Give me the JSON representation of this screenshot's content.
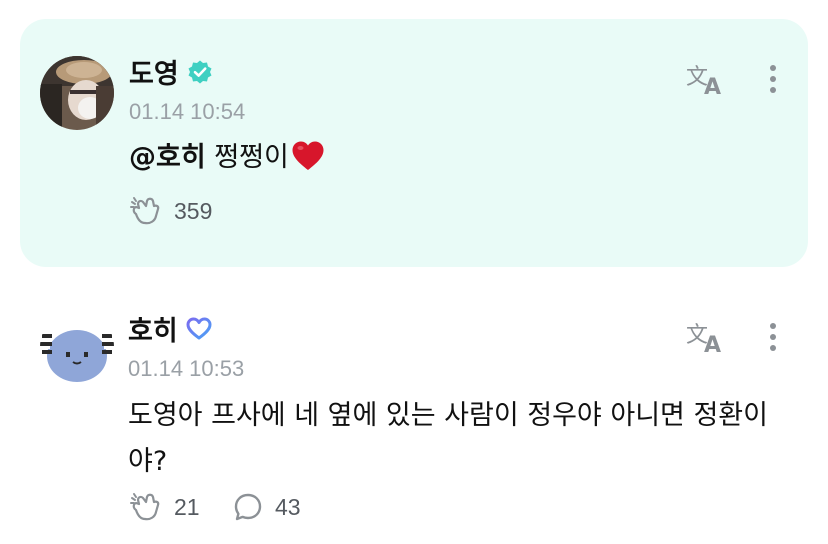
{
  "posts": [
    {
      "author": "도영",
      "badge": "verified-check-icon",
      "timestamp": "01.14 10:54",
      "mention": "@호히",
      "text": "쩡쩡이",
      "emoji": "❤️",
      "likes": "359",
      "highlighted": true,
      "highlight_color": "#e9fbf7",
      "badge_color": "#3fd0c2"
    },
    {
      "author": "호히",
      "badge": "heart-outline-badge-icon",
      "timestamp": "01.14 10:53",
      "text": "도영아 프사에 네 옆에 있는 사람이 정우야 아니면 정환이야?",
      "likes": "21",
      "comments": "43",
      "highlighted": false
    }
  ],
  "colors": {
    "heart": "#d7162b",
    "icon_gray": "#8c9196",
    "timestamp": "#9aa0a6"
  }
}
